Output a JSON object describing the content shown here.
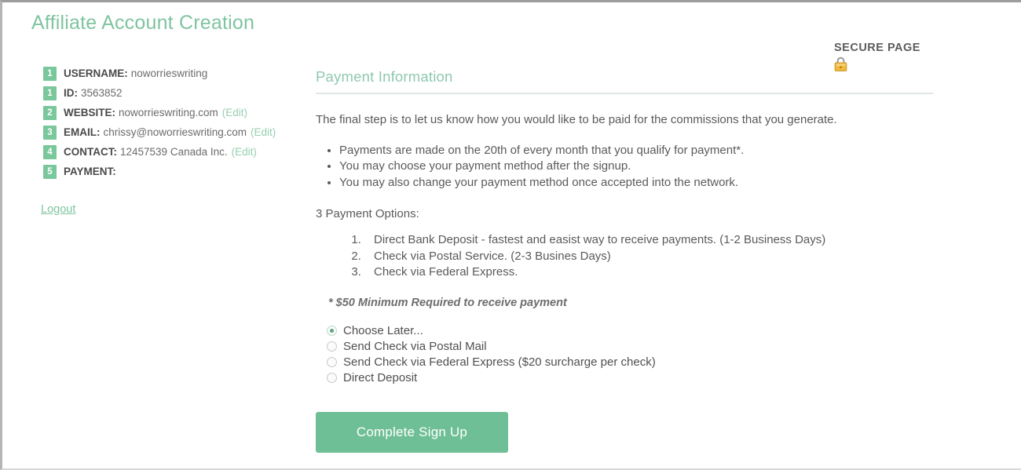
{
  "page": {
    "title": "Affiliate Account Creation"
  },
  "secure": {
    "label": "SECURE PAGE",
    "icon": "lock-icon"
  },
  "account": {
    "rows": [
      {
        "step": "1",
        "key": "USERNAME:",
        "value": "noworrieswriting",
        "edit": ""
      },
      {
        "step": "1",
        "key": "ID:",
        "value": "3563852",
        "edit": ""
      },
      {
        "step": "2",
        "key": "WEBSITE:",
        "value": "noworrieswriting.com",
        "edit": "(Edit)"
      },
      {
        "step": "3",
        "key": "EMAIL:",
        "value": "chrissy@noworrieswriting.com",
        "edit": "(Edit)"
      },
      {
        "step": "4",
        "key": "CONTACT:",
        "value": "12457539 Canada Inc.",
        "edit": "(Edit)"
      },
      {
        "step": "5",
        "key": "PAYMENT:",
        "value": "",
        "edit": ""
      }
    ],
    "logout_label": "Logout"
  },
  "main": {
    "section_title": "Payment Information",
    "intro": "The final step is to let us know how you would like to be paid for the commissions that you generate.",
    "bullets": [
      "Payments are made on the 20th of every month that you qualify for payment*.",
      "You may choose your payment method after the signup.",
      "You may also change your payment method once accepted into the network."
    ],
    "options_heading": "3 Payment Options:",
    "options": [
      "Direct Bank Deposit - fastest and easist way to receive payments. (1-2 Business Days)",
      "Check via Postal Service. (2-3 Busines Days)",
      "Check via Federal Express."
    ],
    "minimum_note": "* $50 Minimum Required to receive payment",
    "payment_methods": [
      {
        "label": "Choose Later...",
        "selected": true
      },
      {
        "label": "Send Check via Postal Mail",
        "selected": false
      },
      {
        "label": "Send Check via Federal Express ($20 surcharge per check)",
        "selected": false
      },
      {
        "label": "Direct Deposit",
        "selected": false
      }
    ],
    "submit_label": "Complete Sign Up"
  },
  "colors": {
    "accent_green": "#7fc4a0",
    "badge_green": "#7ac79b",
    "button_green": "#6fbf96",
    "lock_gold": "#e8b33c",
    "text_gray": "#5a5a5a"
  }
}
